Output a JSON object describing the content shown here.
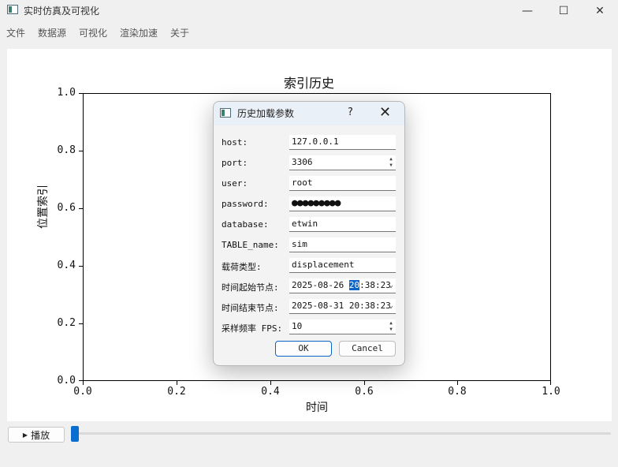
{
  "window": {
    "title": "实时仿真及可视化",
    "min_glyph": "—",
    "max_glyph": "☐",
    "close_glyph": "✕"
  },
  "menu": [
    "文件",
    "数据源",
    "可视化",
    "渲染加速",
    "关于"
  ],
  "chart_data": {
    "type": "line",
    "title": "索引历史",
    "xlabel": "时间",
    "ylabel": "位置索引",
    "xlim": [
      0.0,
      1.0
    ],
    "ylim": [
      0.0,
      1.0
    ],
    "x_ticks": [
      "0.0",
      "0.2",
      "0.4",
      "0.6",
      "0.8",
      "1.0"
    ],
    "y_ticks": [
      "0.0",
      "0.2",
      "0.4",
      "0.6",
      "0.8",
      "1.0"
    ],
    "series": []
  },
  "controls": {
    "play_label": "播放",
    "play_icon": "play-triangle",
    "slider_value": 0
  },
  "dialog": {
    "title": "历史加载参数",
    "help": "?",
    "close": "✕",
    "fields": {
      "host": {
        "label": "host:",
        "value": "127.0.0.1"
      },
      "port": {
        "label": "port:",
        "value": "3306"
      },
      "user": {
        "label": "user:",
        "value": "root"
      },
      "password": {
        "label": "password:",
        "value": "●●●●●●●●●"
      },
      "database": {
        "label": "database:",
        "value": "etwin"
      },
      "table_name": {
        "label": "TABLE_name:",
        "value": "sim"
      },
      "load_type": {
        "label": "载荷类型:",
        "value": "displacement"
      },
      "start_time": {
        "label": "时间起始节点:",
        "value_pre": "2025-08-26 ",
        "value_sel": "20",
        "value_post": ":38:23"
      },
      "end_time": {
        "label": "时间结束节点:",
        "value": "2025-08-31 20:38:23"
      },
      "fps": {
        "label": "采样频率 FPS:",
        "value": "10"
      }
    },
    "ok": "OK",
    "cancel": "Cancel"
  }
}
